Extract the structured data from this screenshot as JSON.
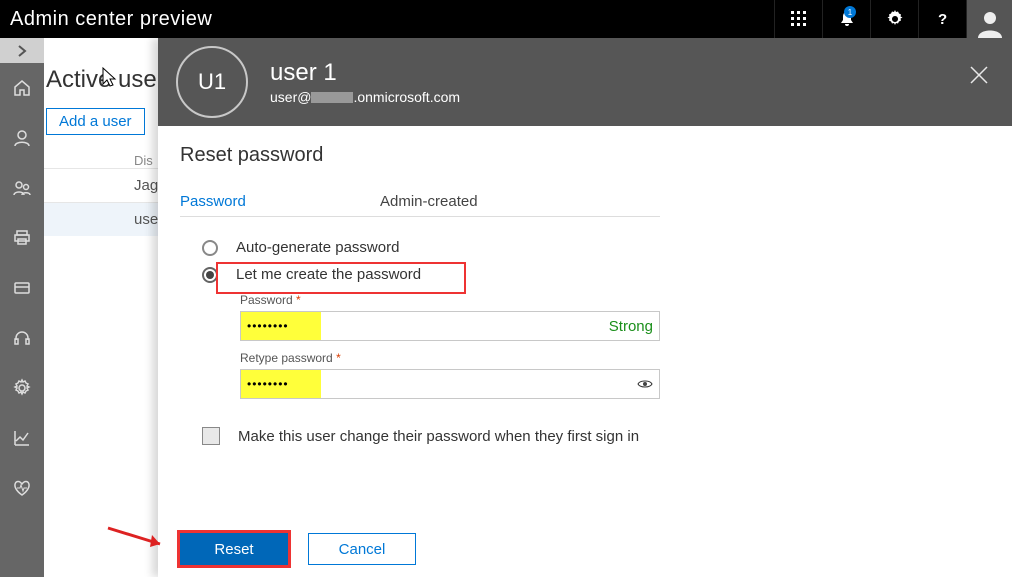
{
  "topbar": {
    "title": "Admin center preview",
    "badge_count": "1"
  },
  "under_page": {
    "heading": "Active users",
    "add_user_label": "Add a user",
    "col_display": "Dis",
    "rows": [
      "Jag",
      "use"
    ]
  },
  "panel": {
    "user_initials": "U1",
    "user_name": "user 1",
    "user_email_left": "user@",
    "user_email_right": ".onmicrosoft.com",
    "heading": "Reset password",
    "kv": {
      "key_label": "Password",
      "value_label": "Admin-created"
    },
    "options": {
      "auto_label": "Auto-generate password",
      "manual_label": "Let me create the password"
    },
    "password_fields": {
      "pw_label": "Password",
      "required_mark": "*",
      "pw_value_mask": "••••••••",
      "strength_label": "Strong",
      "retype_label": "Retype password",
      "retype_value_mask": "••••••••"
    },
    "change_on_login_label": "Make this user change their password when they first sign in",
    "actions": {
      "reset_label": "Reset",
      "cancel_label": "Cancel"
    }
  }
}
